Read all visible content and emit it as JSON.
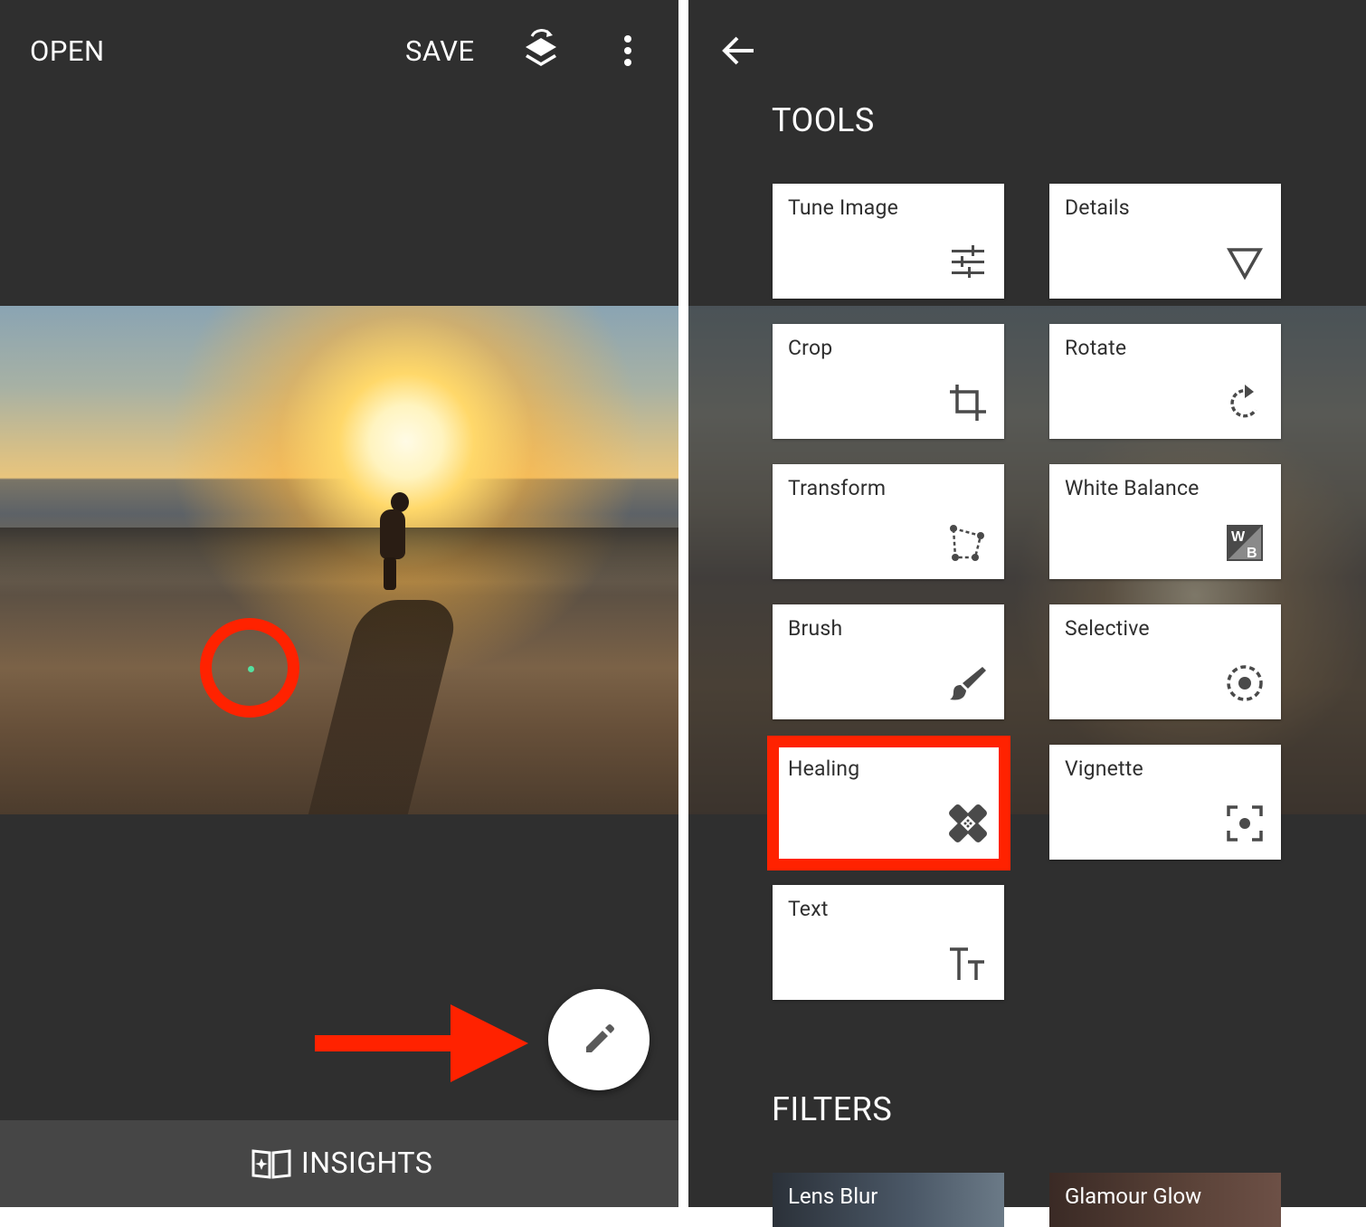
{
  "left_panel": {
    "toolbar": {
      "open_label": "OPEN",
      "save_label": "SAVE",
      "layers_icon": "stack-undo-icon",
      "more_icon": "more-vert-icon"
    },
    "fab_icon": "pencil-icon",
    "bottom_bar": {
      "insights_icon": "insights-book-icon",
      "insights_label": "INSIGHTS"
    },
    "annotation_color": "#ff2200"
  },
  "right_panel": {
    "back_icon": "arrow-back-icon",
    "tools_title": "TOOLS",
    "tools": [
      {
        "label": "Tune Image",
        "icon": "tune-sliders-icon"
      },
      {
        "label": "Details",
        "icon": "triangle-down-icon"
      },
      {
        "label": "Crop",
        "icon": "crop-icon"
      },
      {
        "label": "Rotate",
        "icon": "rotate-icon"
      },
      {
        "label": "Transform",
        "icon": "transform-perspective-icon"
      },
      {
        "label": "White Balance",
        "icon": "white-balance-icon"
      },
      {
        "label": "Brush",
        "icon": "brush-icon"
      },
      {
        "label": "Selective",
        "icon": "selective-target-icon"
      },
      {
        "label": "Healing",
        "icon": "bandage-icon"
      },
      {
        "label": "Vignette",
        "icon": "vignette-focus-icon"
      },
      {
        "label": "Text",
        "icon": "text-size-icon"
      }
    ],
    "highlighted_tool": "Healing",
    "filters_title": "FILTERS",
    "filters": [
      {
        "label": "Lens Blur"
      },
      {
        "label": "Glamour Glow"
      }
    ]
  }
}
